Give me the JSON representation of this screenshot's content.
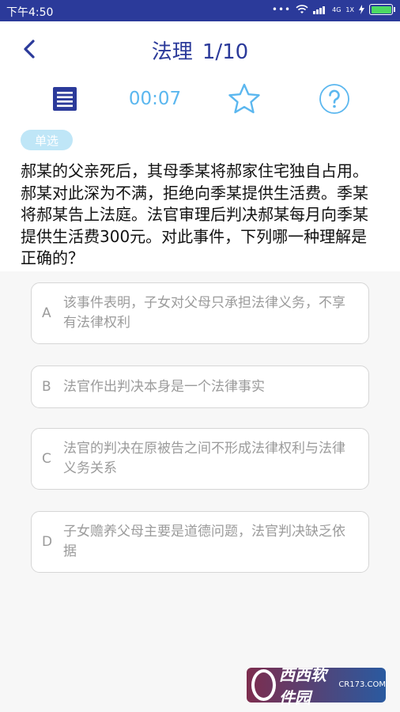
{
  "status_bar": {
    "time": "下午4:50",
    "signal_labels": [
      "4G",
      "1X"
    ],
    "battery_color": "#4cd964"
  },
  "header": {
    "subject": "法理",
    "progress": "1/10",
    "timer": "00:07"
  },
  "question": {
    "type_tag": "单选",
    "text": "郝某的父亲死后，其母季某将郝家住宅独自占用。郝某对此深为不满，拒绝向季某提供生活费。季某将郝某告上法庭。法官审理后判决郝某每月向季某提供生活费300元。对此事件，下列哪一种理解是正确的？"
  },
  "options": [
    {
      "letter": "A",
      "text": "该事件表明，子女对父母只承担法律义务，不享有法律权利"
    },
    {
      "letter": "B",
      "text": "法官作出判决本身是一个法律事实"
    },
    {
      "letter": "C",
      "text": "法官的判决在原被告之间不形成法律权利与法律义务关系"
    },
    {
      "letter": "D",
      "text": "子女赡养父母主要是道德问题，法官判决缺乏依据"
    }
  ],
  "watermark": {
    "main": "西西软件园",
    "sub": "CR173.COM"
  },
  "colors": {
    "status_bar": "#2b3a9a",
    "title": "#2b3a9a",
    "accent": "#5bb7ef",
    "tag_bg": "#bfe6f7"
  },
  "icons": [
    "back-chevron-icon",
    "answer-sheet-icon",
    "star-outline-icon",
    "help-circle-icon"
  ]
}
